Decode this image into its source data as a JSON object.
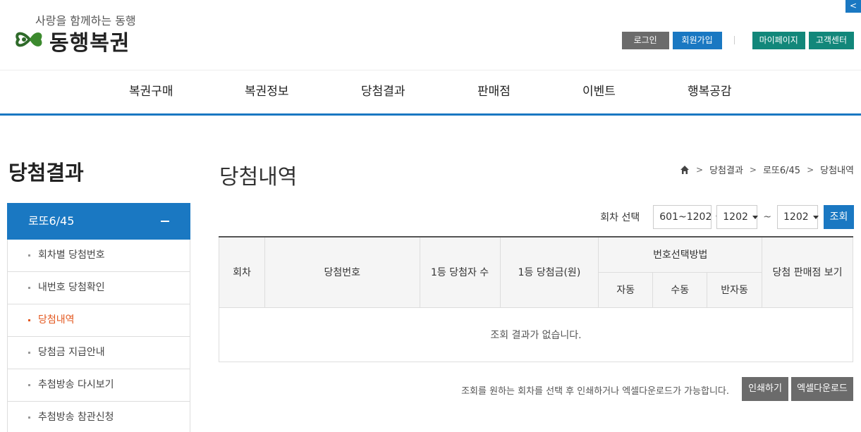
{
  "header": {
    "tagline": "사랑을 함께하는 동행",
    "logo_text": "동행복권",
    "util": {
      "login": "로그인",
      "join": "회원가입",
      "mypage": "마이페이지",
      "customer": "고객센터"
    },
    "side_tab": "<"
  },
  "gnb": [
    "복권구매",
    "복권정보",
    "당첨결과",
    "판매점",
    "이벤트",
    "행복공감"
  ],
  "lnb": {
    "title": "당첨결과",
    "section": "로또6/45",
    "items": [
      {
        "label": "회차별 당첨번호",
        "active": false
      },
      {
        "label": "내번호 당첨확인",
        "active": false
      },
      {
        "label": "당첨내역",
        "active": true
      },
      {
        "label": "당첨금 지급안내",
        "active": false
      },
      {
        "label": "추첨방송 다시보기",
        "active": false
      },
      {
        "label": "추첨방송 참관신청",
        "active": false
      }
    ]
  },
  "content": {
    "title": "당첨내역",
    "breadcrumb": [
      "당첨결과",
      "로또6/45",
      "당첨내역"
    ],
    "filter": {
      "label": "회차 선택",
      "range": "601~1202",
      "from": "1202",
      "tilde": "~",
      "to": "1202",
      "search": "조회"
    },
    "table": {
      "headers": {
        "round": "회차",
        "numbers": "당첨번호",
        "winners": "1등 당첨자 수",
        "prize": "1등 당첨금(원)",
        "method": "번호선택방법",
        "auto": "자동",
        "manual": "수동",
        "semi": "반자동",
        "shops": "당첨 판매점 보기"
      },
      "empty": "조회 결과가 없습니다."
    },
    "note": "조회를 원하는 회차를 선택 후 인쇄하거나 엑셀다운로드가 가능합니다.",
    "print": "인쇄하기",
    "excel": "엑셀다운로드"
  },
  "colors": {
    "primary": "#1a78c2",
    "teal": "#12877a",
    "gray_button": "#6b6b6b",
    "active_menu": "#e3571e"
  }
}
